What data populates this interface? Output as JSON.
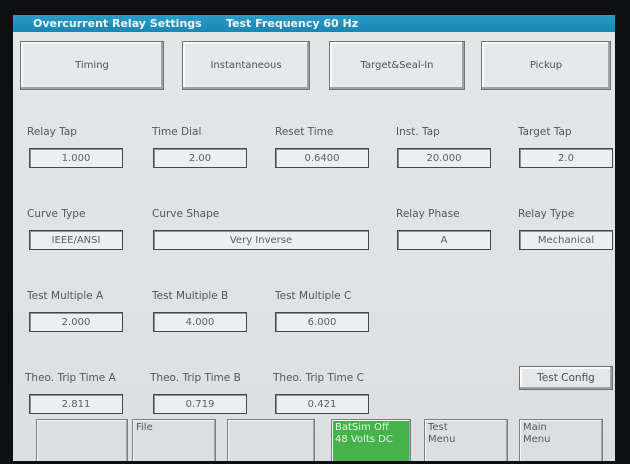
{
  "title_bar": {
    "title": "Overcurrent Relay Settings",
    "frequency": "Test Frequency 60 Hz"
  },
  "tabs": [
    "Timing",
    "Instantaneous",
    "Target&Seal-In",
    "Pickup"
  ],
  "settings": {
    "relay_tap": {
      "label": "Relay Tap",
      "value": "1.000"
    },
    "time_dial": {
      "label": "Time Dial",
      "value": "2.00"
    },
    "reset_time": {
      "label": "Reset Time",
      "value": "0.6400"
    },
    "inst_tap": {
      "label": "Inst. Tap",
      "value": "20.000"
    },
    "target_tap": {
      "label": "Target Tap",
      "value": "2.0"
    },
    "curve_type": {
      "label": "Curve Type",
      "value": "IEEE/ANSI"
    },
    "curve_shape": {
      "label": "Curve Shape",
      "value": "Very Inverse"
    },
    "relay_phase": {
      "label": "Relay Phase",
      "value": "A"
    },
    "relay_type": {
      "label": "Relay Type",
      "value": "Mechanical"
    },
    "test_multiple_a": {
      "label": "Test Multiple A",
      "value": "2.000"
    },
    "test_multiple_b": {
      "label": "Test Multiple B",
      "value": "4.000"
    },
    "test_multiple_c": {
      "label": "Test Multiple C",
      "value": "6.000"
    },
    "trip_time_a": {
      "label": "Theo. Trip Time A",
      "value": "2.811"
    },
    "trip_time_b": {
      "label": "Theo. Trip Time B",
      "value": "0.719"
    },
    "trip_time_c": {
      "label": "Theo. Trip Time C",
      "value": "0.421"
    }
  },
  "test_config_label": "Test Config",
  "softkeys": {
    "file": "File",
    "batsim_line1": "BatSim Off",
    "batsim_line2": "48 Volts DC",
    "test_menu_line1": "Test",
    "test_menu_line2": "Menu",
    "main_menu_line1": "Main",
    "main_menu_line2": "Menu"
  },
  "colors": {
    "title_bar": "#1a86b4",
    "batsim_key": "#45b34a",
    "screen_bg": "#e0e3e4"
  }
}
